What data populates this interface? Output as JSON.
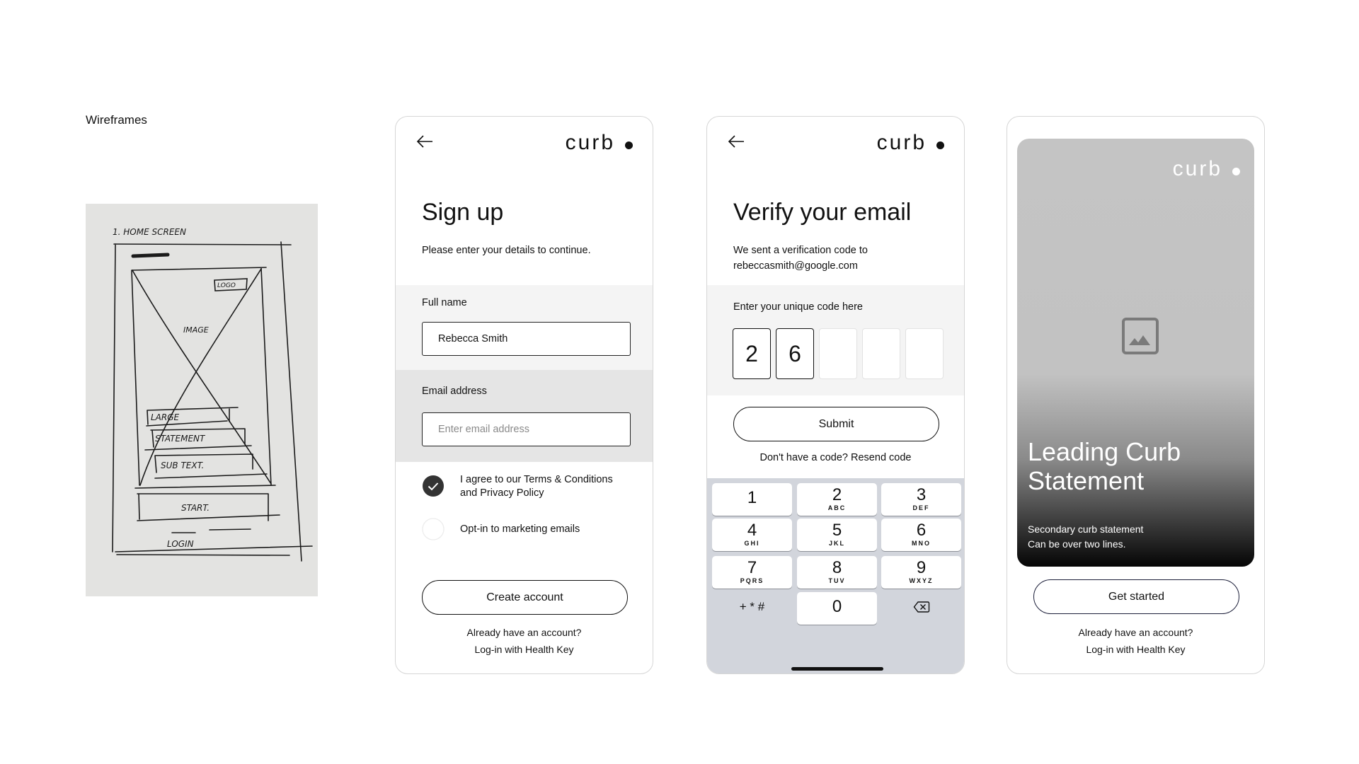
{
  "page_label": "Wireframes",
  "sketch": {
    "heading": "1. HOME SCREEN",
    "logo": "LOGO",
    "image": "IMAGE",
    "large": "LARGE",
    "statement": "STATEMENT",
    "subtext": "SUB TEXT.",
    "start": "START.",
    "login": "LOGIN"
  },
  "brand": {
    "logo": "curb"
  },
  "signup": {
    "title": "Sign up",
    "subtitle": "Please enter your details to continue.",
    "full_name_label": "Full name",
    "full_name_value": "Rebecca Smith",
    "email_label": "Email address",
    "email_placeholder": "Enter email address",
    "terms_line1": "I agree to our Terms & Conditions",
    "terms_line2": "and Privacy Policy",
    "terms_checked": true,
    "marketing_label": "Opt-in to marketing emails",
    "marketing_checked": false,
    "create_button": "Create account",
    "already": "Already have an account?",
    "login_link": "Log-in with Health Key"
  },
  "verify": {
    "title": "Verify your email",
    "subtitle_line1": "We sent a verification code to",
    "subtitle_line2": "rebeccasmith@google.com",
    "code_label": "Enter your unique code here",
    "code_digits": [
      "2",
      "6",
      "",
      "",
      ""
    ],
    "submit_button": "Submit",
    "resend": "Don't have a code? Resend code",
    "keypad": [
      {
        "n": "1",
        "l": ""
      },
      {
        "n": "2",
        "l": "ABC"
      },
      {
        "n": "3",
        "l": "DEF"
      },
      {
        "n": "4",
        "l": "GHI"
      },
      {
        "n": "5",
        "l": "JKL"
      },
      {
        "n": "6",
        "l": "MNO"
      },
      {
        "n": "7",
        "l": "PQRS"
      },
      {
        "n": "8",
        "l": "TUV"
      },
      {
        "n": "9",
        "l": "WXYZ"
      },
      {
        "n": "+ * #",
        "l": ""
      },
      {
        "n": "0",
        "l": ""
      },
      {
        "n": "delete-icon",
        "l": ""
      }
    ],
    "keypad_bg": "#d2d5dc"
  },
  "home": {
    "hero_line1": "Leading Curb",
    "hero_line2": "Statement",
    "sub_line1": "Secondary curb statement",
    "sub_line2": "Can be over two lines.",
    "image_icon": "image-placeholder-icon",
    "start_button": "Get started",
    "already": "Already have an account?",
    "login_link": "Log-in with Health Key",
    "button_border": "#1c1f3a"
  }
}
